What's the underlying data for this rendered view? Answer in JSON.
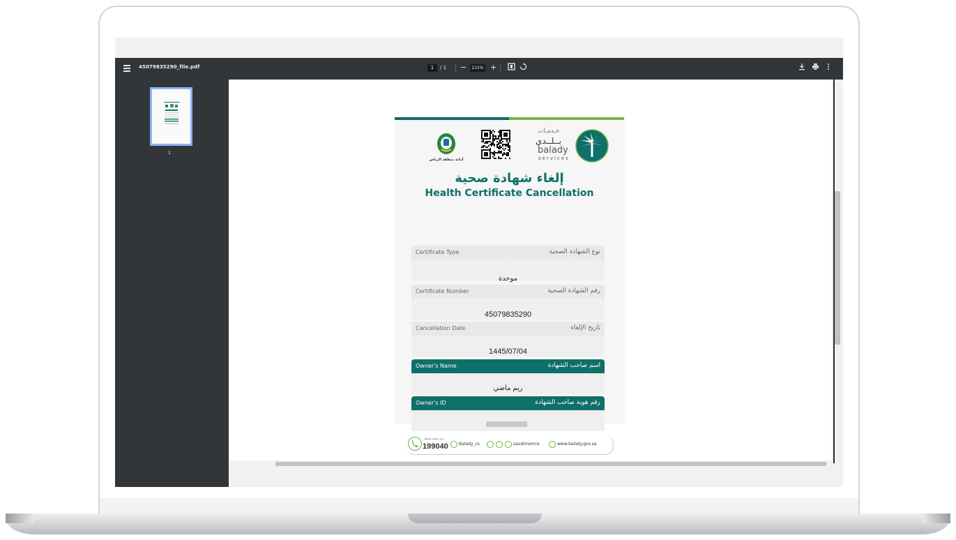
{
  "viewer": {
    "file_name": "45079835290_file.pdf",
    "current_page": "1",
    "total_pages": "/ 1",
    "zoom": "215%",
    "zoom_out": "−",
    "zoom_in": "+",
    "thumbnail_page": "1"
  },
  "document": {
    "header": {
      "amanah_name": "أمانة منطقة الرياض",
      "balady_arabic_top": "خـدمـات",
      "balady_arabic": "بــلــدي",
      "balady_english": "balady",
      "balady_services": "services"
    },
    "title_ar": "إلغاء شهادة صحية",
    "title_en": "Health Certificate Cancellation",
    "fields": [
      {
        "label_en": "Certificate Type",
        "label_ar": "نوع الشهادة الصحية",
        "value": "موحدة"
      },
      {
        "label_en": "Certificate Number",
        "label_ar": "رقم الشهادة الصحية",
        "value": "45079835290"
      },
      {
        "label_en": "Cancellation Date",
        "label_ar": "تاريخ الإلغاء",
        "value": "1445/07/04"
      },
      {
        "label_en": "Owner's Name",
        "label_ar": "اسم صاحب الشهادة",
        "value": "ريم ماضي"
      },
      {
        "label_en": "Owner's ID",
        "label_ar": "رقم هوية صاحب الشهادة",
        "value": ""
      }
    ],
    "footer": {
      "phone_hint": "مركز العناية بالعملاء",
      "phone": "199040",
      "twitter": "Balady_cs",
      "social": "saudimomra",
      "website": "www.balady.gov.sa"
    }
  },
  "colors": {
    "brand_dark": "#0f6f69",
    "brand_light": "#7ab545",
    "toolbar": "#323639"
  }
}
